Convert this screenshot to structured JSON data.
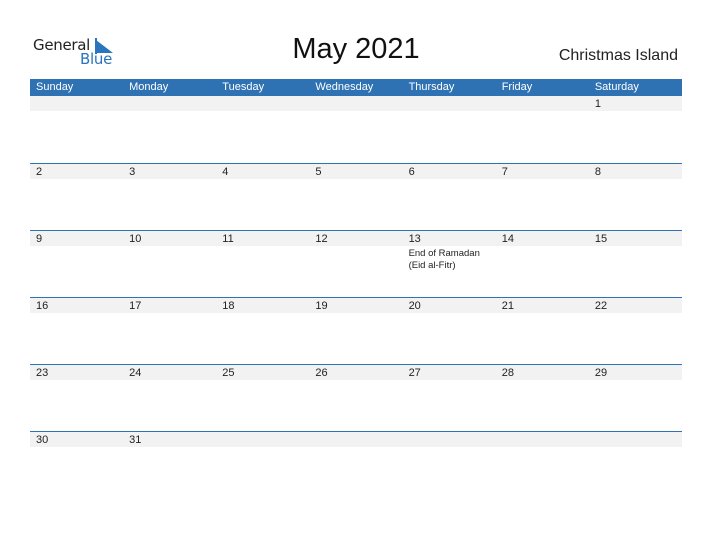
{
  "logo": {
    "word1": "General",
    "word2": "Blue"
  },
  "title": "May 2021",
  "country": "Christmas Island",
  "colors": {
    "accent": "#2f72b4",
    "strip": "#f2f2f2"
  },
  "weekdays": [
    "Sunday",
    "Monday",
    "Tuesday",
    "Wednesday",
    "Thursday",
    "Friday",
    "Saturday"
  ],
  "weeks": [
    [
      "",
      "",
      "",
      "",
      "",
      "",
      "1"
    ],
    [
      "2",
      "3",
      "4",
      "5",
      "6",
      "7",
      "8"
    ],
    [
      "9",
      "10",
      "11",
      "12",
      "13",
      "14",
      "15"
    ],
    [
      "16",
      "17",
      "18",
      "19",
      "20",
      "21",
      "22"
    ],
    [
      "23",
      "24",
      "25",
      "26",
      "27",
      "28",
      "29"
    ],
    [
      "30",
      "31",
      "",
      "",
      "",
      "",
      ""
    ]
  ],
  "events": {
    "13": "End of Ramadan (Eid al-Fitr)"
  }
}
